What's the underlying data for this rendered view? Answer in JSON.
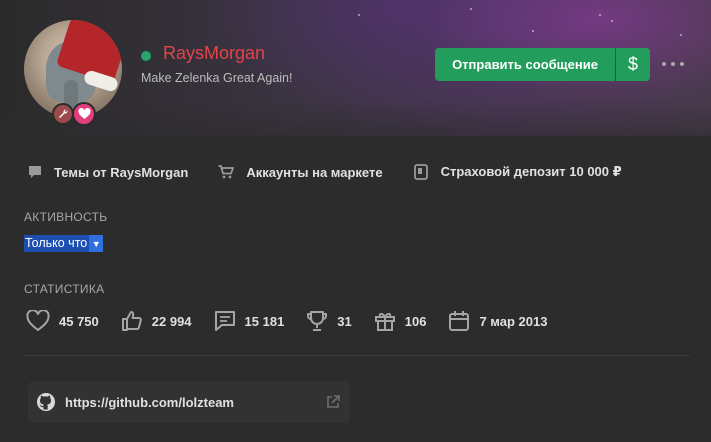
{
  "profile": {
    "username": "RaysMorgan",
    "status_text": "Make Zelenka Great Again!",
    "online": true,
    "colors": {
      "username": "#e0454a",
      "online": "#28a36a",
      "accent": "#229d5c"
    }
  },
  "actions": {
    "message_label": "Отправить сообщение",
    "money_label": "$"
  },
  "links": [
    {
      "label": "Темы от RaysMorgan",
      "icon": "comment-icon"
    },
    {
      "label": "Аккаунты на маркете",
      "icon": "cart-icon"
    },
    {
      "label": "Страховой депозит 10 000 ₽",
      "icon": "deposit-icon"
    }
  ],
  "activity": {
    "title": "АКТИВНОСТЬ",
    "value": "Только что",
    "arrow": "▼"
  },
  "stats": {
    "title": "СТАТИСТИКА",
    "items": [
      {
        "icon": "heart-icon",
        "value": "45 750"
      },
      {
        "icon": "thumbs-up-icon",
        "value": "22 994"
      },
      {
        "icon": "message-icon",
        "value": "15 181"
      },
      {
        "icon": "trophy-icon",
        "value": "31"
      },
      {
        "icon": "gift-icon",
        "value": "106"
      },
      {
        "icon": "calendar-icon",
        "value": "7 мар 2013"
      }
    ]
  },
  "github": {
    "icon": "github-icon",
    "url": "https://github.com/lolzteam"
  }
}
